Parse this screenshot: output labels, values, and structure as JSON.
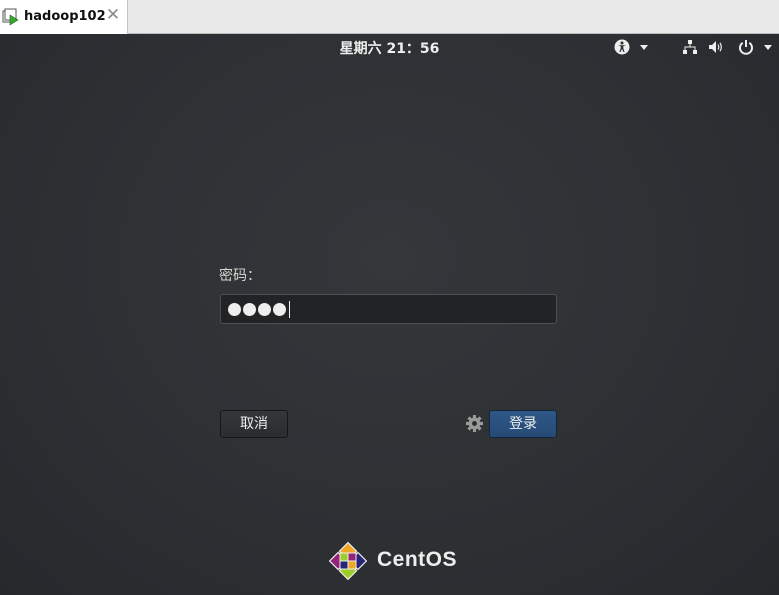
{
  "vm_tab": {
    "title": "hadoop102",
    "icon": "vm-play-icon",
    "close_icon": "close-icon"
  },
  "topbar": {
    "clock": "星期六  21：56",
    "icons": [
      "accessibility-icon",
      "network-icon",
      "volume-icon",
      "power-icon"
    ]
  },
  "login": {
    "password_label": "密码：",
    "password_dots": 4,
    "cancel_label": "取消",
    "login_label": "登录",
    "session_icon": "gear-icon"
  },
  "brand": {
    "logo": "centos-logo-icon",
    "name": "CentOS"
  },
  "colors": {
    "background": "#2b2e31",
    "login_button": "#2a5080",
    "text": "#eeeeec"
  }
}
